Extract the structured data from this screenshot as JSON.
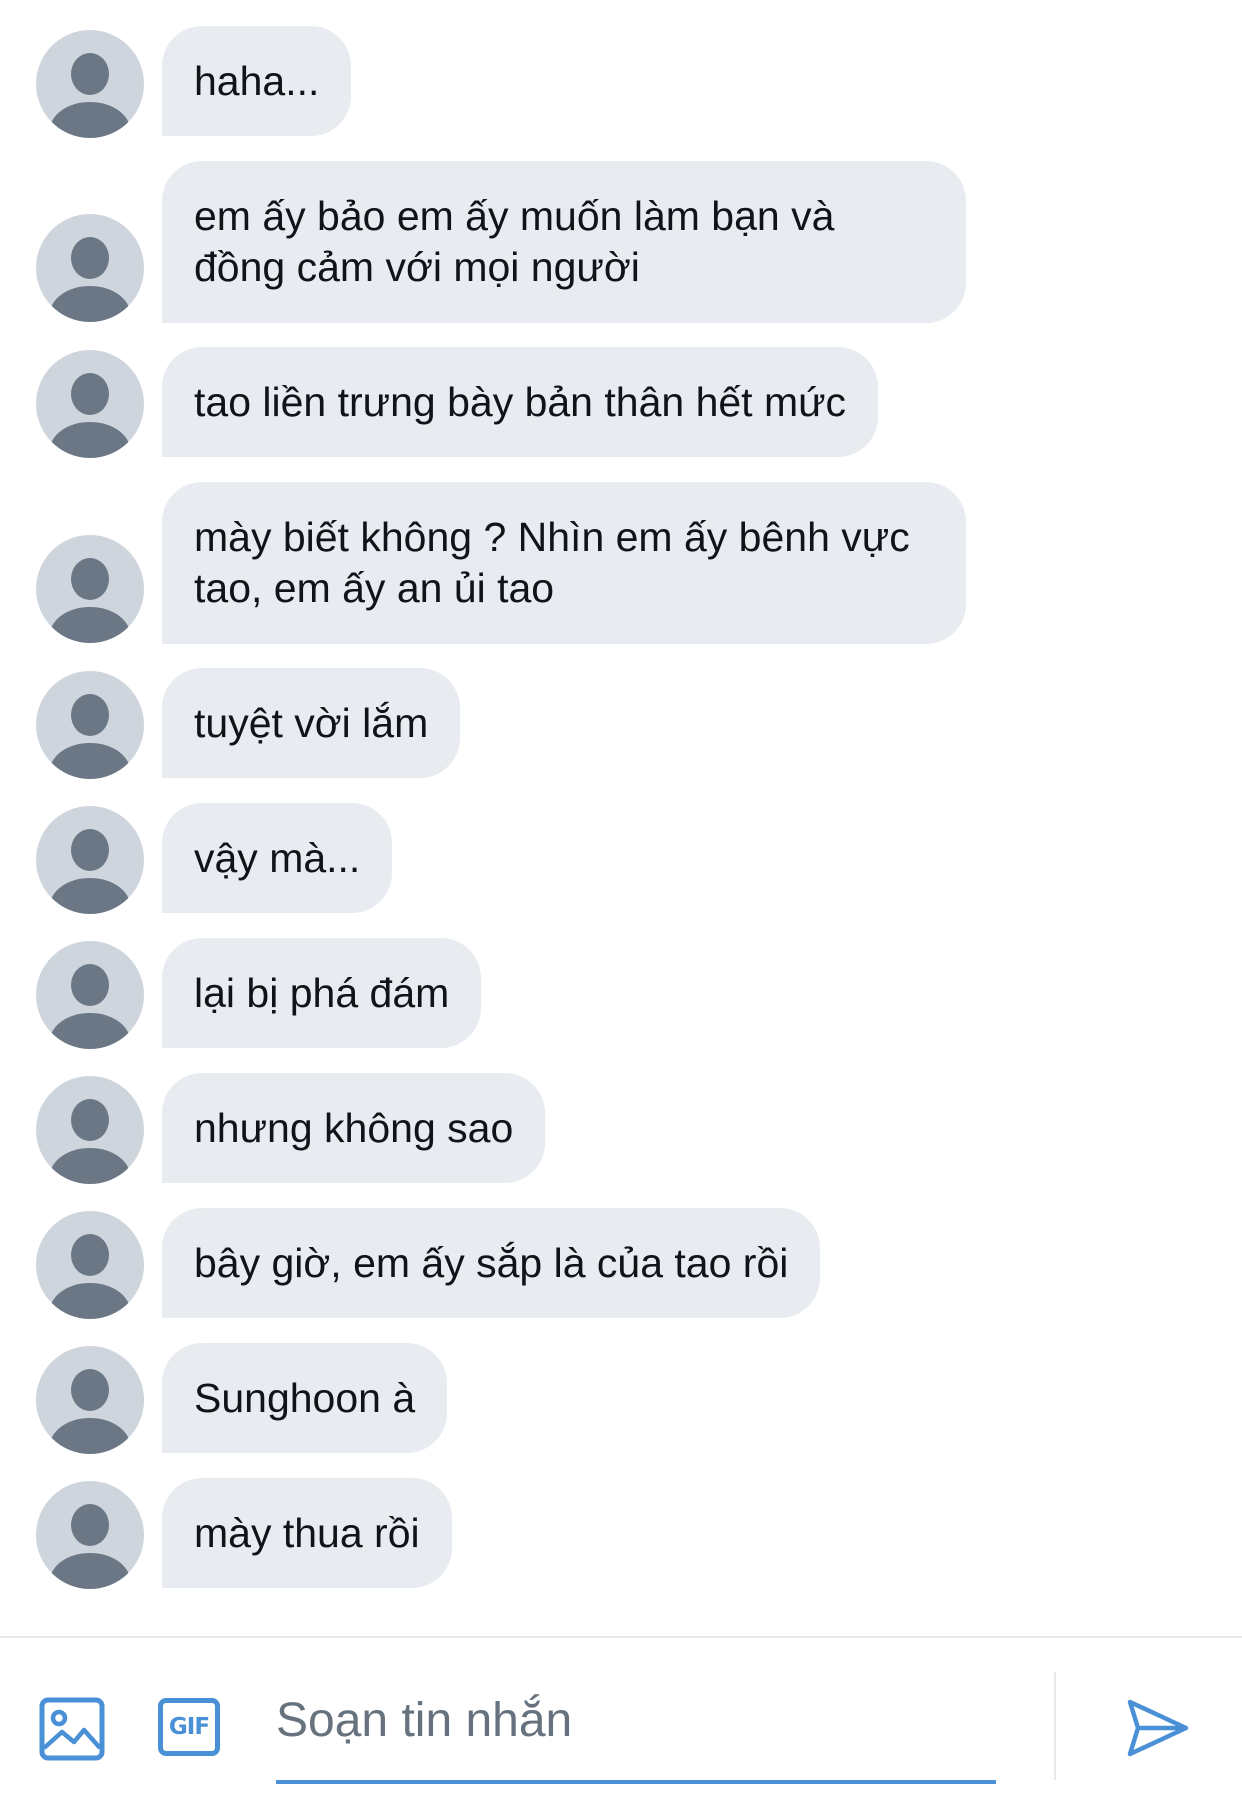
{
  "messages": [
    {
      "text": "haha..."
    },
    {
      "text": "em ấy bảo em ấy muốn làm bạn và đồng cảm với mọi người"
    },
    {
      "text": "tao liền trưng bày bản thân hết mức"
    },
    {
      "text": "mày biết không ? Nhìn em ấy bênh vực tao, em ấy an ủi tao"
    },
    {
      "text": "tuyệt vời lắm"
    },
    {
      "text": "vậy mà..."
    },
    {
      "text": "lại bị phá đám"
    },
    {
      "text": "nhưng không sao"
    },
    {
      "text": "bây giờ, em ấy sắp là của tao rồi"
    },
    {
      "text": "Sunghoon à"
    },
    {
      "text": "mày thua rồi"
    }
  ],
  "composer": {
    "placeholder": "Soạn tin nhắn",
    "value": "",
    "gif_label": "GIF",
    "icons": {
      "media": "image-icon",
      "gif": "gif-icon",
      "send": "send-icon"
    }
  },
  "colors": {
    "bubble": "#e8ecf0",
    "avatar_bg": "#ced5dc",
    "avatar_fg": "#6b7785",
    "accent": "#4a90d6"
  }
}
